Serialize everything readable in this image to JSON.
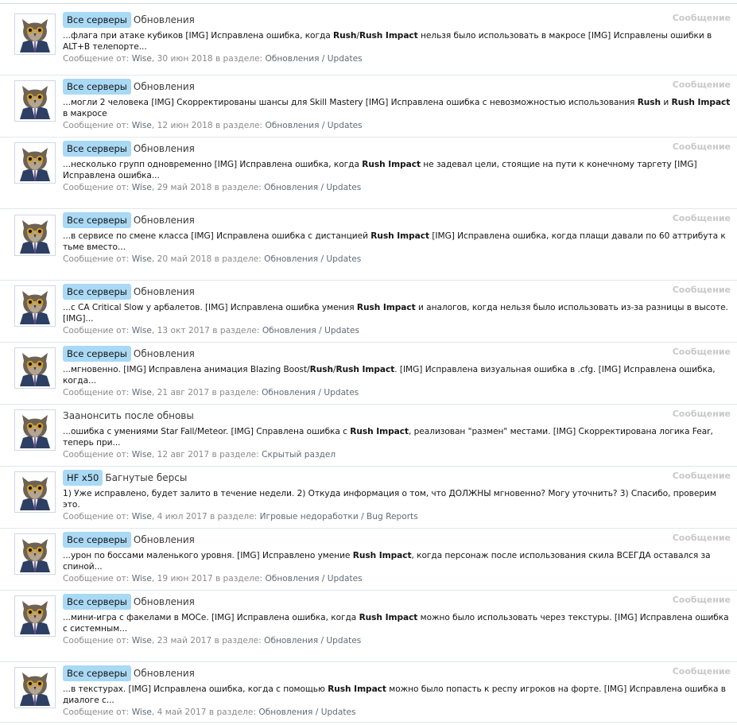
{
  "type_label": "Сообщение",
  "meta_prefix": "Сообщение от:",
  "in_forum": "в разделе:",
  "results": [
    {
      "prefix": "Все серверы",
      "title": "Обновления",
      "snippet": "...флага при атаке кубиков [IMG] Исправлена ошибка, когда <b>Rush</b>/<b>Rush Impact</b> нельзя было использовать в макросе [IMG] Исправлены ошибки в ALT+B телепорте...",
      "author": "Wise",
      "date": "30 июн 2018",
      "forum": "Обновления / Updates"
    },
    {
      "prefix": "Все серверы",
      "title": "Обновления",
      "snippet": "...могли 2 человека [IMG] Скорректированы шансы для Skill Mastery [IMG] Исправлена ошибка с невозможностью использования <b>Rush</b> и <b>Rush Impact</b> в макросе",
      "author": "Wise",
      "date": "12 июн 2018",
      "forum": "Обновления / Updates"
    },
    {
      "prefix": "Все серверы",
      "title": "Обновления",
      "snippet": "...несколько групп одновременно [IMG] Исправлена ошибка, когда <b>Rush Impact</b> не задевал цели, стоящие на пути к конечному таргету [IMG] Исправлена ошибка...",
      "author": "Wise",
      "date": "29 май 2018",
      "forum": "Обновления / Updates"
    },
    {
      "prefix": "Все серверы",
      "title": "Обновления",
      "snippet": "...в сервисе по смене класса [IMG] Исправлена ошибка с дистанцией <b>Rush Impact</b> [IMG] Исправлена ошибка, когда плащи давали по 60 аттрибута к тьме вместо...",
      "author": "Wise",
      "date": "20 май 2018",
      "forum": "Обновления / Updates"
    },
    {
      "prefix": "Все серверы",
      "title": "Обновления",
      "snippet": "...с СА Critical Slow у арбалетов. [IMG] Исправлена ошибка умения <b>Rush Impact</b> и аналогов, когда нельзя было использовать из-за разницы в высоте. [IMG]...",
      "author": "Wise",
      "date": "13 окт 2017",
      "forum": "Обновления / Updates"
    },
    {
      "prefix": "Все серверы",
      "title": "Обновления",
      "snippet": "...мгновенно. [IMG] Исправлена анимация Blazing Boost/<b>Rush</b>/<b>Rush Impact</b>. [IMG] Исправлена визуальная ошибка в .cfg. [IMG] Исправлена ошибка, когда...",
      "author": "Wise",
      "date": "21 авг 2017",
      "forum": "Обновления / Updates"
    },
    {
      "prefix": "",
      "title": "Заанонсить после обновы",
      "snippet": "...ошибка с умениями Star Fall/Meteor. [IMG] Справлена ошибка с <b>Rush Impact</b>, реализован \"размен\" местами. [IMG] Скорректирована логика Fear, теперь при...",
      "author": "Wise",
      "date": "12 авг 2017",
      "forum": "Скрытый раздел"
    },
    {
      "prefix": "HF x50",
      "title": "Багнутые берсы",
      "snippet": "1) Уже исправлено, будет залито в течение недели. 2) Откуда информация о том, что ДОЛЖНЫ мгновенно? Могу уточнить? 3) Спасибо, проверим это.",
      "author": "Wise",
      "date": "4 июл 2017",
      "forum": "Игровые недоработки / Bug Reports"
    },
    {
      "prefix": "Все серверы",
      "title": "Обновления",
      "snippet": "...урон по боссами маленького уровня. [IMG] Исправлено умение <b>Rush Impact</b>, когда персонаж после использования скила ВСЕГДА оставался за спиной...",
      "author": "Wise",
      "date": "19 июн 2017",
      "forum": "Обновления / Updates"
    },
    {
      "prefix": "Все серверы",
      "title": "Обновления",
      "snippet": "...мини-игра с факелами в МОСе. [IMG] Исправлена ошибка, когда <b>Rush Impact</b> можно было использовать через текстуры. [IMG] Исправлена ошибка с системным...",
      "author": "Wise",
      "date": "23 май 2017",
      "forum": "Обновления / Updates"
    },
    {
      "prefix": "Все серверы",
      "title": "Обновления",
      "snippet": "...в текстурах. [IMG] Исправлена ошибка, когда с помощью <b>Rush Impact</b> можно было попасть к респу игроков на форте. [IMG] Исправлена ошибка в диалоге с...",
      "author": "Wise",
      "date": "4 май 2017",
      "forum": "Обновления / Updates"
    }
  ]
}
